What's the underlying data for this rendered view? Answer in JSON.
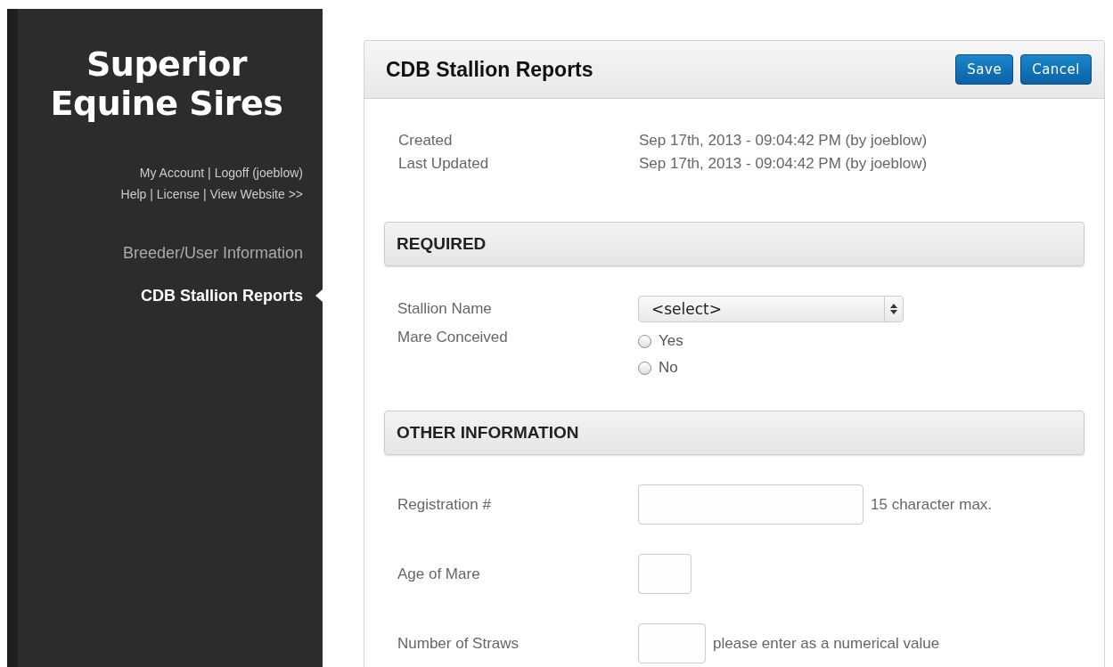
{
  "sidebar": {
    "title": "Superior Equine Sires",
    "link_lines": [
      {
        "separator": "|",
        "links": [
          "My Account",
          "Logoff (joeblow)"
        ]
      },
      {
        "separator": "|",
        "links": [
          "Help",
          "License",
          "View Website >>"
        ]
      }
    ],
    "nav": [
      {
        "label": "Breeder/User Information",
        "selected": false
      },
      {
        "label": "CDB Stallion Reports",
        "selected": true
      }
    ]
  },
  "panel": {
    "title": "CDB Stallion Reports",
    "buttons": [
      "Save",
      "Cancel"
    ],
    "meta": [
      {
        "label": "Created",
        "value": "Sep 17th, 2013 - 09:04:42 PM (by joeblow)"
      },
      {
        "label": "Last Updated",
        "value": "Sep 17th, 2013 - 09:04:42 PM (by joeblow)"
      }
    ],
    "sections": [
      {
        "title": "REQUIRED",
        "fields": [
          {
            "kind": "select",
            "label": "Stallion Name",
            "value": "<select>"
          },
          {
            "kind": "radio",
            "label": "Mare Conceived",
            "options": [
              {
                "label": "Yes",
                "selected": false
              },
              {
                "label": "No",
                "selected": false
              }
            ]
          }
        ]
      },
      {
        "title": "OTHER INFORMATION",
        "fields": [
          {
            "kind": "input",
            "label": "Registration #",
            "hint": "15 character max."
          },
          {
            "kind": "input",
            "label": "Age of Mare"
          },
          {
            "kind": "input",
            "label": "Number of Straws",
            "hint": "please enter as a numerical value"
          }
        ]
      }
    ]
  }
}
